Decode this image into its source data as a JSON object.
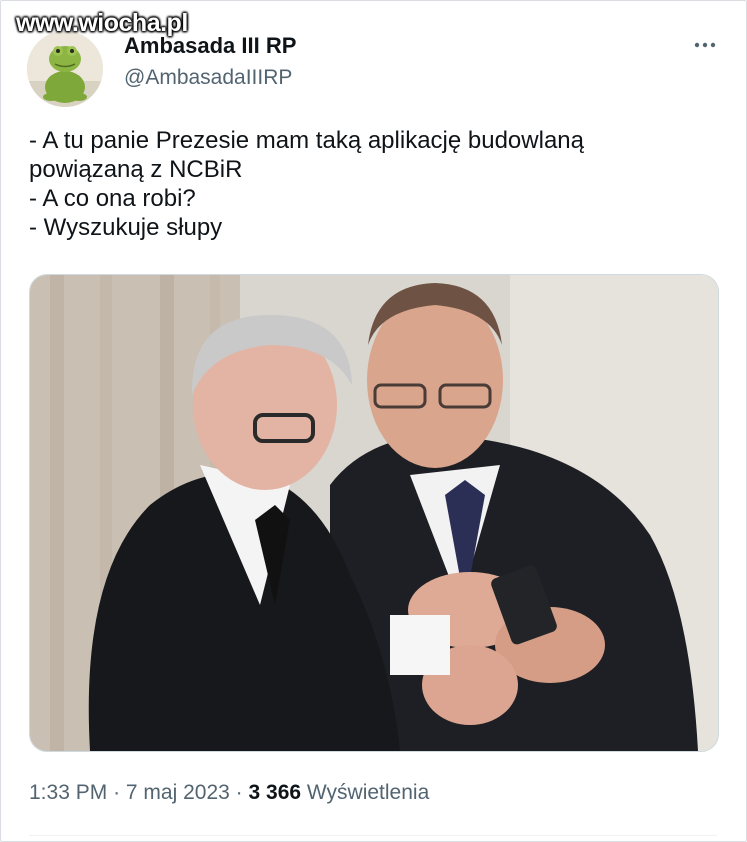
{
  "watermark": "www.wiocha.pl",
  "tweet": {
    "author_name": "Ambasada III RP",
    "author_handle": "@AmbasadaIIIRP",
    "lines": [
      "- A tu panie Prezesie mam taką aplikację budowlaną",
      "powiązaną z NCBiR",
      "- A co ona robi?",
      "- Wyszukuje słupy"
    ],
    "time": "1:33 PM",
    "separator": "·",
    "date": "7 maj 2023",
    "views_count": "3 366",
    "views_label": "Wyświetlenia"
  },
  "icons": {
    "more": "more-options-icon",
    "avatar": "frog-plush-avatar"
  },
  "colors": {
    "text": "#0f1419",
    "secondary": "#536471",
    "border": "#cfd9de"
  }
}
